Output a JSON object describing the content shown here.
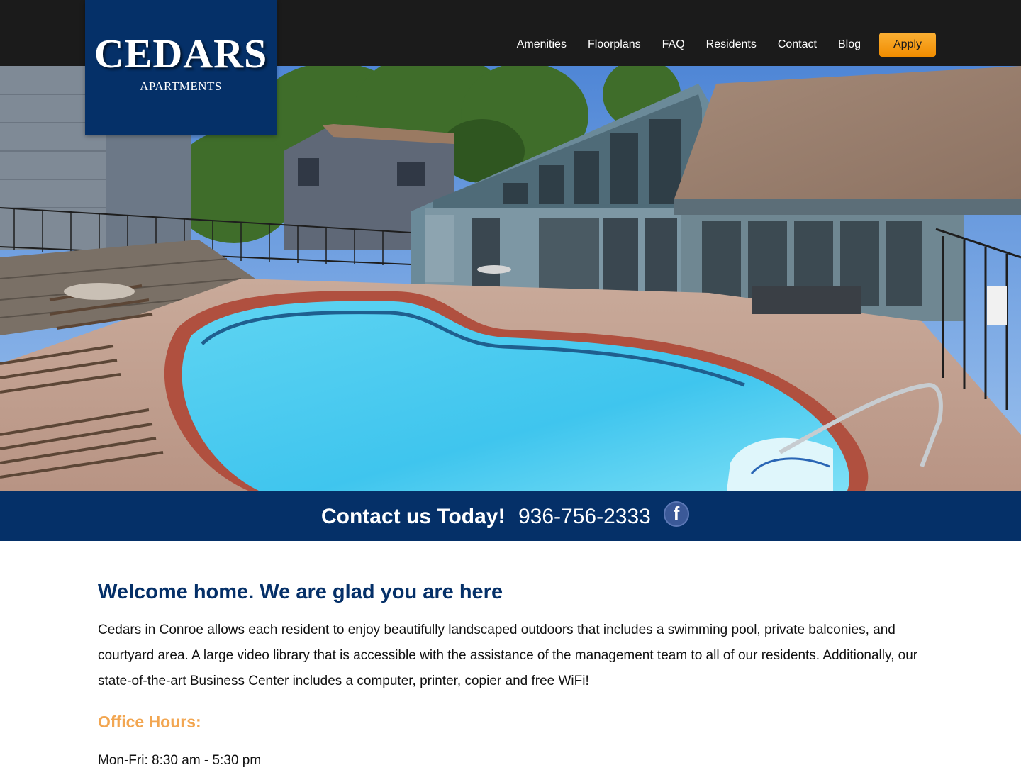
{
  "logo": {
    "title": "CEDARS",
    "subtitle": "APARTMENTS"
  },
  "nav": {
    "items": [
      "Amenities",
      "Floorplans",
      "FAQ",
      "Residents",
      "Contact",
      "Blog"
    ],
    "apply_label": "Apply"
  },
  "contact": {
    "text": "Contact us Today!",
    "phone": "936-756-2333",
    "facebook_letter": "f"
  },
  "main": {
    "welcome": "Welcome home. We are glad you are here",
    "intro": "Cedars in Conroe allows each resident to enjoy beautifully landscaped outdoors that includes a swimming pool, private balconies, and courtyard area. A large video library that is accessible with the assistance of the management team to all of our residents. Additionally, our state-of-the-art Business Center includes a computer, printer, copier and free WiFi!",
    "hours_heading": "Office Hours:",
    "hours_line": "Mon-Fri: 8:30 am - 5:30 pm"
  },
  "colors": {
    "topbar": "#1b1b1b",
    "brand_navy": "#053068",
    "accent_orange": "#f08c00",
    "hours_orange": "#f2a651",
    "facebook_blue": "#3b5998"
  },
  "icons": {
    "facebook": "facebook-icon"
  }
}
